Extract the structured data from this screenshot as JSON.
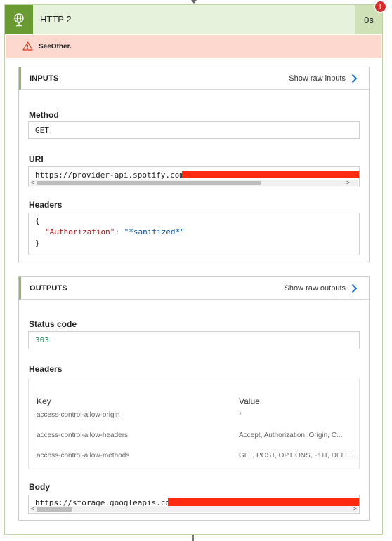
{
  "action": {
    "title": "HTTP 2",
    "duration": "0s",
    "error_badge": "!",
    "error_message": "SeeOther."
  },
  "inputs": {
    "section_title": "INPUTS",
    "raw_link": "Show raw inputs",
    "method_label": "Method",
    "method_value": "GET",
    "uri_label": "URI",
    "uri_value": "https://provider-api.spotify.com",
    "headers_label": "Headers",
    "headers_open": "{",
    "headers_key": "\"Authorization\"",
    "headers_colon": ": ",
    "headers_value": "\"*sanitized*\"",
    "headers_close": "}"
  },
  "outputs": {
    "section_title": "OUTPUTS",
    "raw_link": "Show raw outputs",
    "status_label": "Status code",
    "status_value": "303",
    "headers_label": "Headers",
    "columns": [
      "Key",
      "Value"
    ],
    "rows": [
      {
        "key": "access-control-allow-origin",
        "value": "*"
      },
      {
        "key": "access-control-allow-headers",
        "value": "Accept, Authorization, Origin, C..."
      },
      {
        "key": "access-control-allow-methods",
        "value": "GET, POST, OPTIONS, PUT, DELE..."
      }
    ],
    "body_label": "Body",
    "body_value": "https://storage.googleapis.co"
  },
  "icons": {
    "action_icon": "globe-icon",
    "warning_icon": "warning-icon",
    "chevron_icon": "chevron-right-icon"
  },
  "colors": {
    "header_bg": "#e7f2dc",
    "icon_bg": "#6a9a32",
    "error_bar": "#fcd8ce",
    "badge_red": "#d72c2c",
    "accent_blue": "#1a73d9",
    "status_green": "#1a8a5a",
    "json_key": "#a31515",
    "json_string": "#0451a5"
  }
}
